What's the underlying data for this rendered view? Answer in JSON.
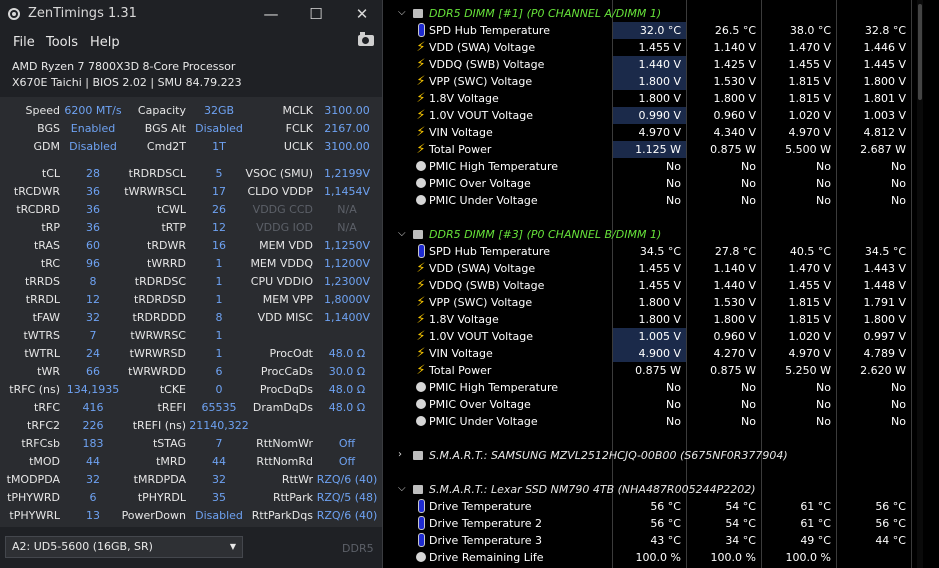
{
  "zentimings": {
    "title": "ZenTimings 1.31",
    "controls": {
      "minimize": "—",
      "maximize": "☐",
      "close": "✕"
    },
    "menu": [
      "File",
      "Tools",
      "Help"
    ],
    "cpu": "AMD Ryzen 7 7800X3D 8-Core Processor",
    "board": "X670E Taichi | BIOS 2.02 | SMU 84.79.223",
    "top_rows": [
      [
        "Speed",
        "6200 MT/s",
        "Capacity",
        "32GB",
        "MCLK",
        "3100.00"
      ],
      [
        "BGS",
        "Enabled",
        "BGS Alt",
        "Disabled",
        "FCLK",
        "2167.00"
      ],
      [
        "GDM",
        "Disabled",
        "Cmd2T",
        "1T",
        "UCLK",
        "3100.00"
      ]
    ],
    "timing_rows": [
      [
        "tCL",
        "28",
        "tRDRDSCL",
        "5",
        "VSOC (SMU)",
        "1,2199V"
      ],
      [
        "tRCDWR",
        "36",
        "tWRWRSCL",
        "17",
        "CLDO VDDP",
        "1,1454V"
      ],
      [
        "tRCDRD",
        "36",
        "tCWL",
        "26",
        "VDDG CCD",
        "N/A"
      ],
      [
        "tRP",
        "36",
        "tRTP",
        "12",
        "VDDG IOD",
        "N/A"
      ],
      [
        "tRAS",
        "60",
        "tRDWR",
        "16",
        "MEM VDD",
        "1,1250V"
      ],
      [
        "tRC",
        "96",
        "tWRRD",
        "1",
        "MEM VDDQ",
        "1,1200V"
      ],
      [
        "tRRDS",
        "8",
        "tRDRDSC",
        "1",
        "CPU VDDIO",
        "1,2300V"
      ],
      [
        "tRRDL",
        "12",
        "tRDRDSD",
        "1",
        "MEM VPP",
        "1,8000V"
      ],
      [
        "tFAW",
        "32",
        "tRDRDDD",
        "8",
        "VDD MISC",
        "1,1400V"
      ],
      [
        "tWTRS",
        "7",
        "tWRWRSC",
        "1",
        "",
        ""
      ],
      [
        "tWTRL",
        "24",
        "tWRWRSD",
        "1",
        "ProcOdt",
        "48.0 Ω"
      ],
      [
        "tWR",
        "66",
        "tWRWRDD",
        "6",
        "ProcCaDs",
        "30.0 Ω"
      ],
      [
        "tRFC (ns)",
        "134,1935",
        "tCKE",
        "0",
        "ProcDqDs",
        "48.0 Ω"
      ],
      [
        "tRFC",
        "416",
        "tREFI",
        "65535",
        "DramDqDs",
        "48.0 Ω"
      ],
      [
        "tRFC2",
        "226",
        "tREFI (ns)",
        "21140,322",
        "",
        ""
      ],
      [
        "tRFCsb",
        "183",
        "tSTAG",
        "7",
        "RttNomWr",
        "Off"
      ],
      [
        "tMOD",
        "44",
        "tMRD",
        "44",
        "RttNomRd",
        "Off"
      ],
      [
        "tMODPDA",
        "32",
        "tMRDPDA",
        "32",
        "RttWr",
        "RZQ/6 (40)"
      ],
      [
        "tPHYWRD",
        "6",
        "tPHYRDL",
        "35",
        "RttPark",
        "RZQ/5 (48)"
      ],
      [
        "tPHYWRL",
        "13",
        "PowerDown",
        "Disabled",
        "RttParkDqs",
        "RZQ/6 (40)"
      ]
    ],
    "dimm_select": "A2: UD5-5600 (16GB, SR)",
    "mem_type": "DDR5"
  },
  "hwinfo": {
    "sections": [
      {
        "name": "DDR5 DIMM [#1] (P0 CHANNEL A/DIMM 1)",
        "expanded": true,
        "name_color": "#66e23a",
        "sensors": [
          {
            "icon": "therm",
            "name": "SPD Hub Temperature",
            "values": [
              "32.0 °C",
              "26.5 °C",
              "38.0 °C",
              "32.8 °C"
            ],
            "highlight": true
          },
          {
            "icon": "bolt",
            "name": "VDD (SWA) Voltage",
            "values": [
              "1.455 V",
              "1.140 V",
              "1.470 V",
              "1.446 V"
            ],
            "highlight": false
          },
          {
            "icon": "bolt",
            "name": "VDDQ (SWB) Voltage",
            "values": [
              "1.440 V",
              "1.425 V",
              "1.455 V",
              "1.445 V"
            ],
            "highlight": true
          },
          {
            "icon": "bolt",
            "name": "VPP (SWC) Voltage",
            "values": [
              "1.800 V",
              "1.530 V",
              "1.815 V",
              "1.800 V"
            ],
            "highlight": true
          },
          {
            "icon": "bolt",
            "name": "1.8V Voltage",
            "values": [
              "1.800 V",
              "1.800 V",
              "1.815 V",
              "1.801 V"
            ],
            "highlight": false
          },
          {
            "icon": "bolt",
            "name": "1.0V VOUT Voltage",
            "values": [
              "0.990 V",
              "0.960 V",
              "1.020 V",
              "1.003 V"
            ],
            "highlight": true
          },
          {
            "icon": "bolt",
            "name": "VIN Voltage",
            "values": [
              "4.970 V",
              "4.340 V",
              "4.970 V",
              "4.812 V"
            ],
            "highlight": false
          },
          {
            "icon": "bolt",
            "name": "Total Power",
            "values": [
              "1.125 W",
              "0.875 W",
              "5.500 W",
              "2.687 W"
            ],
            "highlight": true
          },
          {
            "icon": "pmic",
            "name": "PMIC High Temperature",
            "values": [
              "No",
              "No",
              "No",
              "No"
            ],
            "highlight": false
          },
          {
            "icon": "pmic",
            "name": "PMIC Over Voltage",
            "values": [
              "No",
              "No",
              "No",
              "No"
            ],
            "highlight": false
          },
          {
            "icon": "pmic",
            "name": "PMIC Under Voltage",
            "values": [
              "No",
              "No",
              "No",
              "No"
            ],
            "highlight": false
          }
        ]
      },
      {
        "name": "DDR5 DIMM [#3] (P0 CHANNEL B/DIMM 1)",
        "expanded": true,
        "name_color": "#66e23a",
        "sensors": [
          {
            "icon": "therm",
            "name": "SPD Hub Temperature",
            "values": [
              "34.5 °C",
              "27.8 °C",
              "40.5 °C",
              "34.5 °C"
            ],
            "highlight": false
          },
          {
            "icon": "bolt",
            "name": "VDD (SWA) Voltage",
            "values": [
              "1.455 V",
              "1.140 V",
              "1.470 V",
              "1.443 V"
            ],
            "highlight": false
          },
          {
            "icon": "bolt",
            "name": "VDDQ (SWB) Voltage",
            "values": [
              "1.455 V",
              "1.440 V",
              "1.455 V",
              "1.448 V"
            ],
            "highlight": false
          },
          {
            "icon": "bolt",
            "name": "VPP (SWC) Voltage",
            "values": [
              "1.800 V",
              "1.530 V",
              "1.815 V",
              "1.791 V"
            ],
            "highlight": false
          },
          {
            "icon": "bolt",
            "name": "1.8V Voltage",
            "values": [
              "1.800 V",
              "1.800 V",
              "1.815 V",
              "1.800 V"
            ],
            "highlight": false
          },
          {
            "icon": "bolt",
            "name": "1.0V VOUT Voltage",
            "values": [
              "1.005 V",
              "0.960 V",
              "1.020 V",
              "0.997 V"
            ],
            "highlight": true
          },
          {
            "icon": "bolt",
            "name": "VIN Voltage",
            "values": [
              "4.900 V",
              "4.270 V",
              "4.970 V",
              "4.789 V"
            ],
            "highlight": true
          },
          {
            "icon": "bolt",
            "name": "Total Power",
            "values": [
              "0.875 W",
              "0.875 W",
              "5.250 W",
              "2.620 W"
            ],
            "highlight": false
          },
          {
            "icon": "pmic",
            "name": "PMIC High Temperature",
            "values": [
              "No",
              "No",
              "No",
              "No"
            ],
            "highlight": false
          },
          {
            "icon": "pmic",
            "name": "PMIC Over Voltage",
            "values": [
              "No",
              "No",
              "No",
              "No"
            ],
            "highlight": false
          },
          {
            "icon": "pmic",
            "name": "PMIC Under Voltage",
            "values": [
              "No",
              "No",
              "No",
              "No"
            ],
            "highlight": false
          }
        ]
      },
      {
        "name": "S.M.A.R.T.: SAMSUNG MZVL2512HCJQ-00B00 (S675NF0R377904)",
        "expanded": false,
        "name_color": "#e8e8e8",
        "sensors": []
      },
      {
        "name": "S.M.A.R.T.: Lexar SSD NM790 4TB (NHA487R005244P2202)",
        "expanded": true,
        "name_color": "#e8e8e8",
        "sensors": [
          {
            "icon": "therm",
            "name": "Drive Temperature",
            "values": [
              "56 °C",
              "54 °C",
              "61 °C",
              "56 °C"
            ],
            "highlight": false
          },
          {
            "icon": "therm",
            "name": "Drive Temperature 2",
            "values": [
              "56 °C",
              "54 °C",
              "61 °C",
              "56 °C"
            ],
            "highlight": false
          },
          {
            "icon": "therm",
            "name": "Drive Temperature 3",
            "values": [
              "43 °C",
              "34 °C",
              "49 °C",
              "44 °C"
            ],
            "highlight": false
          },
          {
            "icon": "pmic",
            "name": "Drive Remaining Life",
            "values": [
              "100.0 %",
              "100.0 %",
              "100.0 %",
              ""
            ],
            "highlight": false
          }
        ]
      }
    ]
  }
}
